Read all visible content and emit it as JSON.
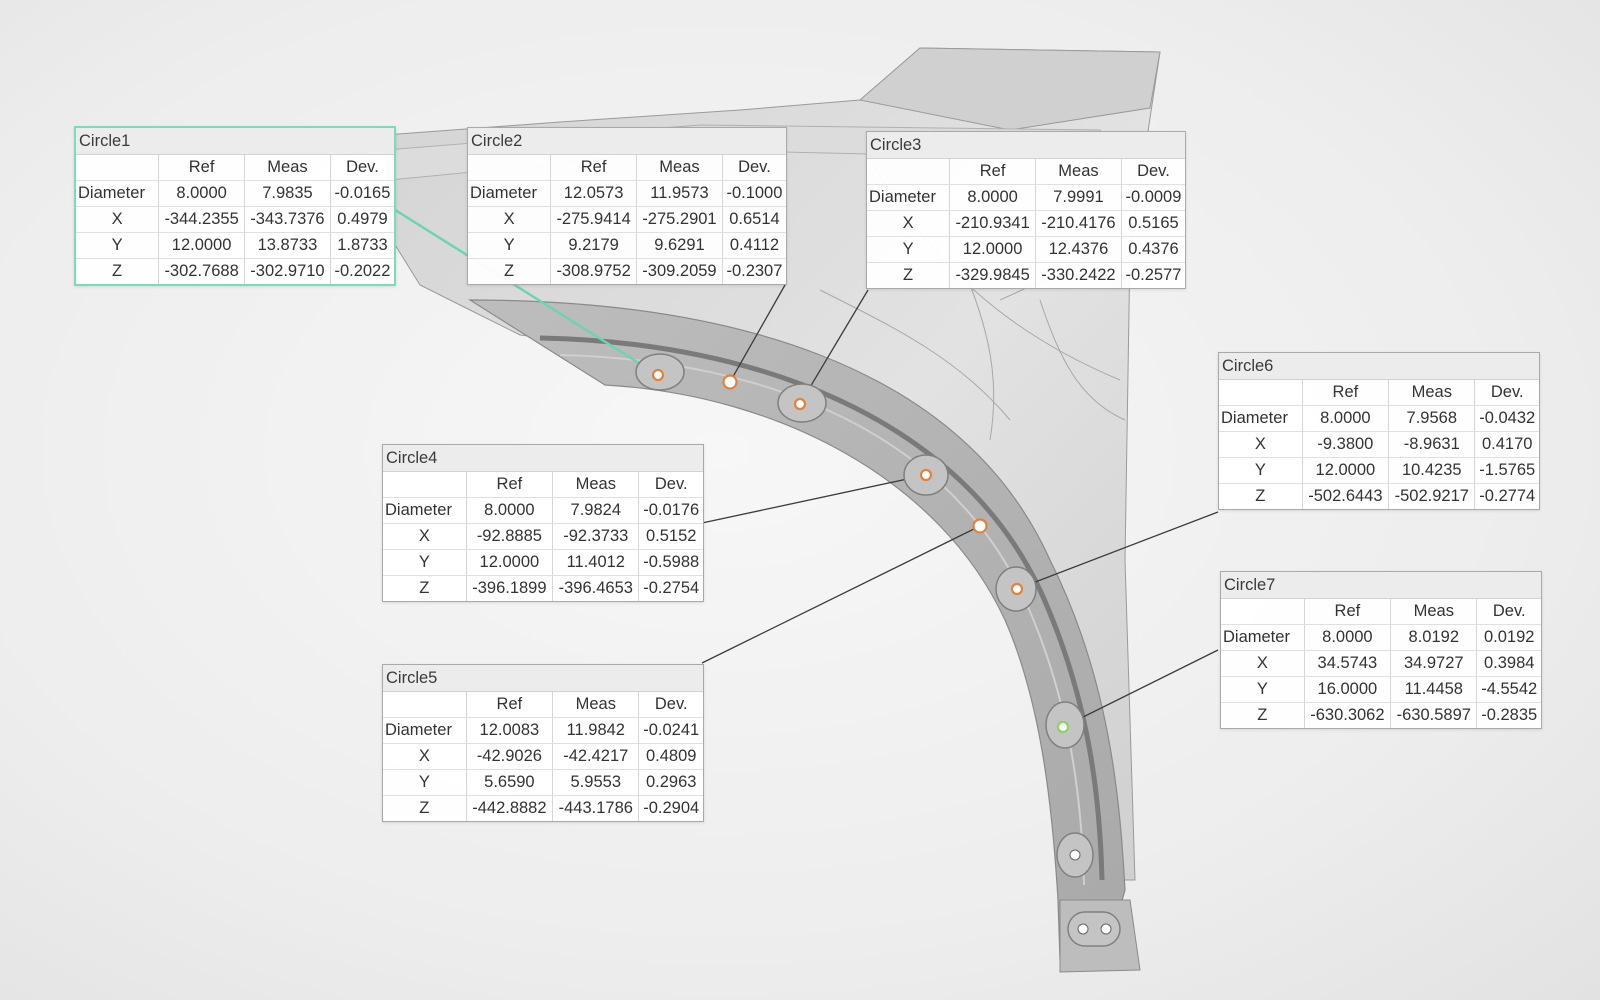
{
  "table_headers": {
    "ref": "Ref",
    "meas": "Meas",
    "dev": "Dev."
  },
  "colors": {
    "selected_outline": "#7fd9bd",
    "leader_selected": "#6cd3b3",
    "leader_default": "#3c3c3c",
    "hole_marker": "#e2823a",
    "hole_marker_highlight": "#8fd06a",
    "part_surface": "#d8d8d8"
  },
  "circles": [
    {
      "title": "Circle1",
      "selected": true,
      "rows": [
        {
          "label": "Diameter",
          "ref": "8.0000",
          "meas": "7.9835",
          "dev": "-0.0165"
        },
        {
          "label": "X",
          "ref": "-344.2355",
          "meas": "-343.7376",
          "dev": "0.4979"
        },
        {
          "label": "Y",
          "ref": "12.0000",
          "meas": "13.8733",
          "dev": "1.8733"
        },
        {
          "label": "Z",
          "ref": "-302.7688",
          "meas": "-302.9710",
          "dev": "-0.2022"
        }
      ]
    },
    {
      "title": "Circle2",
      "selected": false,
      "rows": [
        {
          "label": "Diameter",
          "ref": "12.0573",
          "meas": "11.9573",
          "dev": "-0.1000"
        },
        {
          "label": "X",
          "ref": "-275.9414",
          "meas": "-275.2901",
          "dev": "0.6514"
        },
        {
          "label": "Y",
          "ref": "9.2179",
          "meas": "9.6291",
          "dev": "0.4112"
        },
        {
          "label": "Z",
          "ref": "-308.9752",
          "meas": "-309.2059",
          "dev": "-0.2307"
        }
      ]
    },
    {
      "title": "Circle3",
      "selected": false,
      "rows": [
        {
          "label": "Diameter",
          "ref": "8.0000",
          "meas": "7.9991",
          "dev": "-0.0009"
        },
        {
          "label": "X",
          "ref": "-210.9341",
          "meas": "-210.4176",
          "dev": "0.5165"
        },
        {
          "label": "Y",
          "ref": "12.0000",
          "meas": "12.4376",
          "dev": "0.4376"
        },
        {
          "label": "Z",
          "ref": "-329.9845",
          "meas": "-330.2422",
          "dev": "-0.2577"
        }
      ]
    },
    {
      "title": "Circle4",
      "selected": false,
      "rows": [
        {
          "label": "Diameter",
          "ref": "8.0000",
          "meas": "7.9824",
          "dev": "-0.0176"
        },
        {
          "label": "X",
          "ref": "-92.8885",
          "meas": "-92.3733",
          "dev": "0.5152"
        },
        {
          "label": "Y",
          "ref": "12.0000",
          "meas": "11.4012",
          "dev": "-0.5988"
        },
        {
          "label": "Z",
          "ref": "-396.1899",
          "meas": "-396.4653",
          "dev": "-0.2754"
        }
      ]
    },
    {
      "title": "Circle5",
      "selected": false,
      "rows": [
        {
          "label": "Diameter",
          "ref": "12.0083",
          "meas": "11.9842",
          "dev": "-0.0241"
        },
        {
          "label": "X",
          "ref": "-42.9026",
          "meas": "-42.4217",
          "dev": "0.4809"
        },
        {
          "label": "Y",
          "ref": "5.6590",
          "meas": "5.9553",
          "dev": "0.2963"
        },
        {
          "label": "Z",
          "ref": "-442.8882",
          "meas": "-443.1786",
          "dev": "-0.2904"
        }
      ]
    },
    {
      "title": "Circle6",
      "selected": false,
      "rows": [
        {
          "label": "Diameter",
          "ref": "8.0000",
          "meas": "7.9568",
          "dev": "-0.0432"
        },
        {
          "label": "X",
          "ref": "-9.3800",
          "meas": "-8.9631",
          "dev": "0.4170"
        },
        {
          "label": "Y",
          "ref": "12.0000",
          "meas": "10.4235",
          "dev": "-1.5765"
        },
        {
          "label": "Z",
          "ref": "-502.6443",
          "meas": "-502.9217",
          "dev": "-0.2774"
        }
      ]
    },
    {
      "title": "Circle7",
      "selected": false,
      "rows": [
        {
          "label": "Diameter",
          "ref": "8.0000",
          "meas": "8.0192",
          "dev": "0.0192"
        },
        {
          "label": "X",
          "ref": "34.5743",
          "meas": "34.9727",
          "dev": "0.3984"
        },
        {
          "label": "Y",
          "ref": "16.0000",
          "meas": "11.4458",
          "dev": "-4.5542"
        },
        {
          "label": "Z",
          "ref": "-630.3062",
          "meas": "-630.5897",
          "dev": "-0.2835"
        }
      ]
    }
  ]
}
